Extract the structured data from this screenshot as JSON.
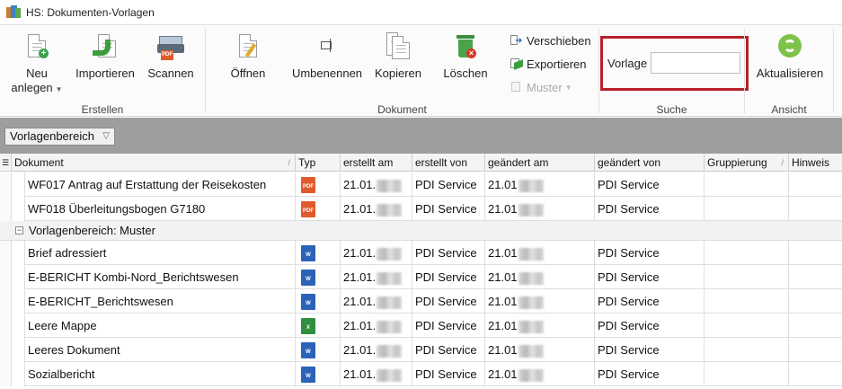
{
  "window": {
    "title": "HS: Dokumenten-Vorlagen"
  },
  "ribbon": {
    "groups": {
      "erstellen": "Erstellen",
      "dokument": "Dokument",
      "suche": "Suche",
      "ansicht": "Ansicht"
    },
    "buttons": {
      "neu_line1": "Neu",
      "neu_line2": "anlegen",
      "importieren": "Importieren",
      "scannen": "Scannen",
      "oeffnen": "Öffnen",
      "umbenennen": "Umbenennen",
      "kopieren": "Kopieren",
      "loeschen": "Löschen",
      "verschieben": "Verschieben",
      "exportieren": "Exportieren",
      "muster": "Muster",
      "aktualisieren": "Aktualisieren"
    },
    "search": {
      "label": "Vorlage",
      "value": ""
    }
  },
  "grouping": {
    "chip": "Vorlagenbereich"
  },
  "grid": {
    "columns": [
      "Dokument",
      "Typ",
      "erstellt am",
      "erstellt von",
      "geändert am",
      "geändert von",
      "Gruppierung",
      "Hinweis"
    ],
    "rows_top": [
      {
        "dokument": "WF017 Antrag auf Erstattung der Reisekosten",
        "typ": "pdf",
        "erstellt_am": "21.01.",
        "erstellt_von": "PDI Service",
        "geaendert_am": "21.01",
        "geaendert_von": "PDI Service"
      },
      {
        "dokument": "WF018 Überleitungsbogen G7180",
        "typ": "pdf",
        "erstellt_am": "21.01.",
        "erstellt_von": "PDI Service",
        "geaendert_am": "21.01",
        "geaendert_von": "PDI Service"
      }
    ],
    "group_row": "Vorlagenbereich: Muster",
    "rows_group": [
      {
        "dokument": "Brief adressiert",
        "typ": "word",
        "erstellt_am": "21.01.",
        "erstellt_von": "PDI Service",
        "geaendert_am": "21.01",
        "geaendert_von": "PDI Service"
      },
      {
        "dokument": "E-BERICHT Kombi-Nord_Berichtswesen",
        "typ": "word",
        "erstellt_am": "21.01.",
        "erstellt_von": "PDI Service",
        "geaendert_am": "21.01",
        "geaendert_von": "PDI Service"
      },
      {
        "dokument": "E-BERICHT_Berichtswesen",
        "typ": "word",
        "erstellt_am": "21.01.",
        "erstellt_von": "PDI Service",
        "geaendert_am": "21.01",
        "geaendert_von": "PDI Service"
      },
      {
        "dokument": "Leere Mappe",
        "typ": "excel",
        "erstellt_am": "21.01.",
        "erstellt_von": "PDI Service",
        "geaendert_am": "21.01",
        "geaendert_von": "PDI Service"
      },
      {
        "dokument": "Leeres Dokument",
        "typ": "word",
        "erstellt_am": "21.01.",
        "erstellt_von": "PDI Service",
        "geaendert_am": "21.01",
        "geaendert_von": "PDI Service"
      },
      {
        "dokument": "Sozialbericht",
        "typ": "word",
        "erstellt_am": "21.01.",
        "erstellt_von": "PDI Service",
        "geaendert_am": "21.01",
        "geaendert_von": "PDI Service"
      }
    ]
  },
  "colors": {
    "highlight": "#b8202a",
    "pdf": "#e05a2b",
    "word": "#2b63b8",
    "excel": "#2f8f3e"
  }
}
